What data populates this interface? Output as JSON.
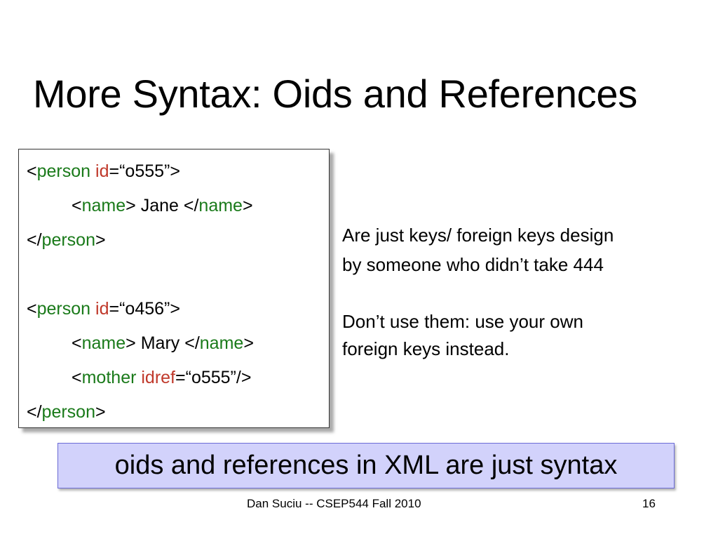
{
  "slide": {
    "title": "More Syntax: Oids and References",
    "code": {
      "l1": {
        "lt": "<",
        "tag": "person",
        "sp": " ",
        "attr": "id",
        "rest": "=“o555”>"
      },
      "l2": {
        "lt": "<",
        "tag": "name",
        "gt": ">",
        "text": " Jane ",
        "lt2": "</",
        "tag2": "name",
        "gt2": ">"
      },
      "l3": {
        "lt": "</",
        "tag": "person",
        "gt": ">"
      },
      "l4": {
        "lt": "<",
        "tag": "person",
        "sp": " ",
        "attr": "id",
        "rest": "=“o456”>"
      },
      "l5": {
        "lt": "<",
        "tag": "name",
        "gt": ">",
        "text": " Mary ",
        "lt2": "</",
        "tag2": "name",
        "gt2": ">"
      },
      "l6": {
        "lt": "<",
        "tag": "mother",
        "sp": " ",
        "attr": "idref",
        "rest": "=“o555”/>"
      },
      "l7": {
        "lt": "</",
        "tag": "person",
        "gt": ">"
      }
    },
    "notes": {
      "line1": "Are just keys/ foreign keys design",
      "line2": "by someone who didn’t take 444",
      "line3": "Don’t use them: use your own",
      "line4": "foreign keys instead."
    },
    "banner": "oids and references in XML are just syntax",
    "footer": "Dan Suciu -- CSEP544 Fall 2010",
    "page_number": "16"
  },
  "colors": {
    "tag": "#1a7a1a",
    "attribute": "#c0392b",
    "banner_background": "#d2d2fb",
    "banner_border": "#6b6bd6"
  }
}
